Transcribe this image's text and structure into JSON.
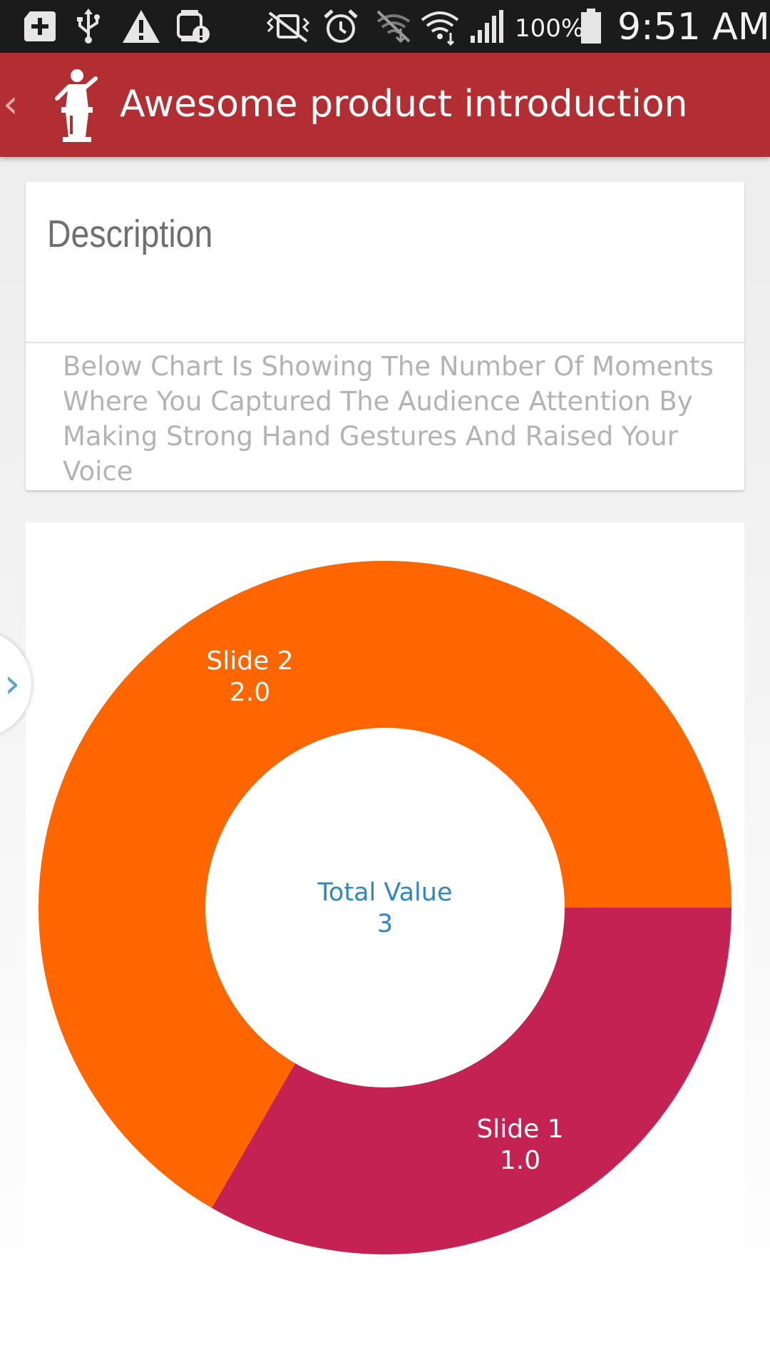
{
  "status_bar": {
    "icons": [
      "add-box-icon",
      "usb-icon",
      "warning-icon",
      "watch-alert-icon",
      "vibrate-off-icon",
      "alarm-icon",
      "bluetooth-off-icon",
      "wifi-icon",
      "signal-icon",
      "battery-icon"
    ],
    "battery_percent": "100%",
    "time": "9:51 AM",
    "bar_color": "#1b1b1b"
  },
  "app_bar": {
    "back_icon": "chevron-left-icon",
    "logo_icon": "speaker-podium-icon",
    "title": "Awesome product introduction",
    "color": "#b32e33"
  },
  "description_card": {
    "heading": "Description",
    "text": "Below Chart Is Showing The Number Of Moments Where You Captured The Audience Attention By Making Strong Hand Gestures And Raised Your Voice"
  },
  "drawer": {
    "chevron": "›",
    "icon": "chevron-right-icon"
  },
  "chart_data": {
    "type": "pie",
    "variant": "donut",
    "title": "",
    "categories": [
      "Slide 1",
      "Slide 2"
    ],
    "values": [
      1.0,
      2.0
    ],
    "value_labels": [
      "1.0",
      "2.0"
    ],
    "colors": [
      "#c42252",
      "#ff6600"
    ],
    "center_label": "Total Value",
    "center_value": "3",
    "legend": "none"
  }
}
